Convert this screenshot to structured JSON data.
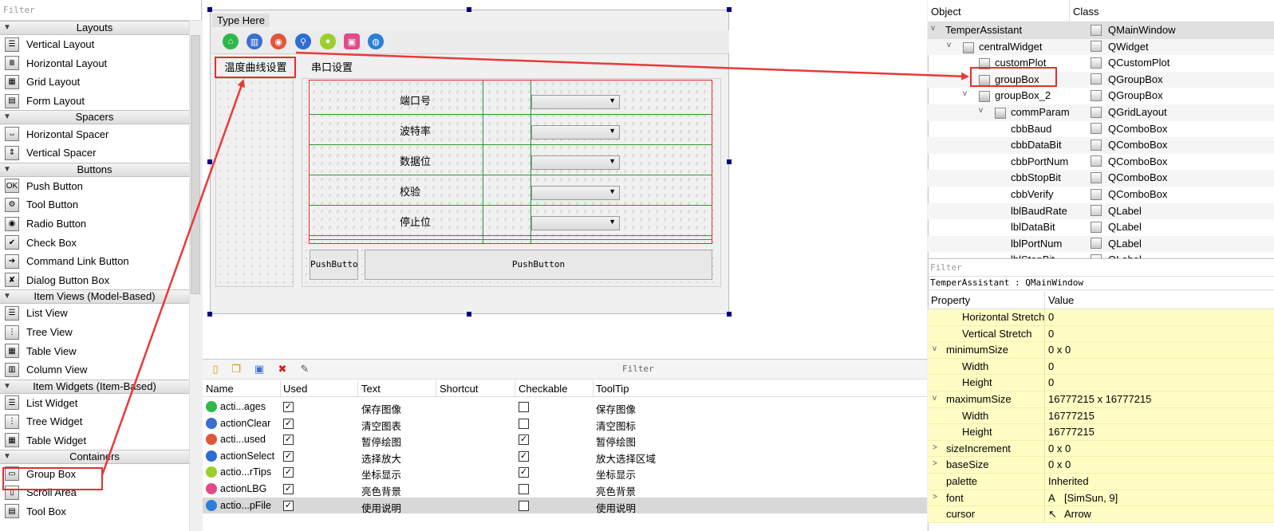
{
  "widget_box": {
    "filter_placeholder": "Filter",
    "categories": [
      {
        "label": "Layouts",
        "items": [
          "Vertical Layout",
          "Horizontal Layout",
          "Grid Layout",
          "Form Layout"
        ]
      },
      {
        "label": "Spacers",
        "items": [
          "Horizontal Spacer",
          "Vertical Spacer"
        ]
      },
      {
        "label": "Buttons",
        "items": [
          "Push Button",
          "Tool Button",
          "Radio Button",
          "Check Box",
          "Command Link Button",
          "Dialog Button Box"
        ]
      },
      {
        "label": "Item Views (Model-Based)",
        "items": [
          "List View",
          "Tree View",
          "Table View",
          "Column View"
        ]
      },
      {
        "label": "Item Widgets (Item-Based)",
        "items": [
          "List Widget",
          "Tree Widget",
          "Table Widget"
        ]
      },
      {
        "label": "Containers",
        "items": [
          "Group Box",
          "Scroll Area",
          "Tool Box"
        ]
      }
    ]
  },
  "form": {
    "menubar_placeholder": "Type Here",
    "toolbar_icons": [
      "save-image-icon",
      "clear-icon",
      "pause-icon",
      "zoom-icon",
      "tips-icon",
      "background-icon",
      "help-icon"
    ],
    "tab1_label": "温度曲线设置",
    "tab2_label": "串口设置",
    "grid_labels": [
      "端口号",
      "波特率",
      "数据位",
      "校验",
      "停止位"
    ],
    "pushbutton_small": "PushButton",
    "pushbutton_large": "PushButton"
  },
  "action_editor": {
    "filter_label": "Filter",
    "columns": [
      "Name",
      "Used",
      "Text",
      "Shortcut",
      "Checkable",
      "ToolTip"
    ],
    "rows": [
      {
        "name": "acti...ages",
        "used": true,
        "text": "保存图像",
        "shortcut": "",
        "checkable": false,
        "tooltip": "保存图像",
        "icon_color": "#2db84a"
      },
      {
        "name": "actionClear",
        "used": true,
        "text": "清空图表",
        "shortcut": "",
        "checkable": false,
        "tooltip": "清空图标",
        "icon_color": "#3a6fd0"
      },
      {
        "name": "acti...used",
        "used": true,
        "text": "暂停绘图",
        "shortcut": "",
        "checkable": true,
        "tooltip": "暂停绘图",
        "icon_color": "#e2553b"
      },
      {
        "name": "actionSelect",
        "used": true,
        "text": "选择放大",
        "shortcut": "",
        "checkable": true,
        "tooltip": "放大选择区域",
        "icon_color": "#2d6cd6"
      },
      {
        "name": "actio...rTips",
        "used": true,
        "text": "坐标显示",
        "shortcut": "",
        "checkable": true,
        "tooltip": "坐标显示",
        "icon_color": "#9bcf2a"
      },
      {
        "name": "actionLBG",
        "used": true,
        "text": "亮色背景",
        "shortcut": "",
        "checkable": false,
        "tooltip": "亮色背景",
        "icon_color": "#e24a8a"
      },
      {
        "name": "actio...pFile",
        "used": true,
        "text": "使用说明",
        "shortcut": "",
        "checkable": false,
        "tooltip": "使用说明",
        "icon_color": "#2a7fd8"
      }
    ]
  },
  "object_inspector": {
    "col_object": "Object",
    "col_class": "Class",
    "rows": [
      {
        "name": "TemperAssistant",
        "class": "QMainWindow",
        "depth": 0,
        "expand": "v"
      },
      {
        "name": "centralWidget",
        "class": "QWidget",
        "depth": 1,
        "expand": "v"
      },
      {
        "name": "customPlot",
        "class": "QCustomPlot",
        "depth": 2,
        "expand": ""
      },
      {
        "name": "groupBox",
        "class": "QGroupBox",
        "depth": 2,
        "expand": ""
      },
      {
        "name": "groupBox_2",
        "class": "QGroupBox",
        "depth": 2,
        "expand": "v"
      },
      {
        "name": "commParam",
        "class": "QGridLayout",
        "depth": 3,
        "expand": "v"
      },
      {
        "name": "cbbBaud",
        "class": "QComboBox",
        "depth": 4,
        "expand": ""
      },
      {
        "name": "cbbDataBit",
        "class": "QComboBox",
        "depth": 4,
        "expand": ""
      },
      {
        "name": "cbbPortNum",
        "class": "QComboBox",
        "depth": 4,
        "expand": ""
      },
      {
        "name": "cbbStopBit",
        "class": "QComboBox",
        "depth": 4,
        "expand": ""
      },
      {
        "name": "cbbVerify",
        "class": "QComboBox",
        "depth": 4,
        "expand": ""
      },
      {
        "name": "lblBaudRate",
        "class": "QLabel",
        "depth": 4,
        "expand": ""
      },
      {
        "name": "lblDataBit",
        "class": "QLabel",
        "depth": 4,
        "expand": ""
      },
      {
        "name": "lblPortNum",
        "class": "QLabel",
        "depth": 4,
        "expand": ""
      },
      {
        "name": "lblStopBit",
        "class": "QLabel",
        "depth": 4,
        "expand": ""
      }
    ]
  },
  "property_editor": {
    "filter_placeholder": "Filter",
    "title": "TemperAssistant : QMainWindow",
    "col_property": "Property",
    "col_value": "Value",
    "rows": [
      {
        "name": "Horizontal Stretch",
        "value": "0",
        "indent": 2,
        "expand": ""
      },
      {
        "name": "Vertical Stretch",
        "value": "0",
        "indent": 2,
        "expand": ""
      },
      {
        "name": "minimumSize",
        "value": "0 x 0",
        "indent": 1,
        "expand": "v"
      },
      {
        "name": "Width",
        "value": "0",
        "indent": 2,
        "expand": ""
      },
      {
        "name": "Height",
        "value": "0",
        "indent": 2,
        "expand": ""
      },
      {
        "name": "maximumSize",
        "value": "16777215 x 16777215",
        "indent": 1,
        "expand": "v"
      },
      {
        "name": "Width",
        "value": "16777215",
        "indent": 2,
        "expand": ""
      },
      {
        "name": "Height",
        "value": "16777215",
        "indent": 2,
        "expand": ""
      },
      {
        "name": "sizeIncrement",
        "value": "0 x 0",
        "indent": 1,
        "expand": ">"
      },
      {
        "name": "baseSize",
        "value": "0 x 0",
        "indent": 1,
        "expand": ">"
      },
      {
        "name": "palette",
        "value": "Inherited",
        "indent": 1,
        "expand": ""
      },
      {
        "name": "font",
        "value": "[SimSun, 9]",
        "indent": 1,
        "expand": ">",
        "icon": "A"
      },
      {
        "name": "cursor",
        "value": "Arrow",
        "indent": 1,
        "expand": "",
        "icon": "↖"
      }
    ]
  },
  "annotation": {
    "color": "#e83a3a"
  }
}
